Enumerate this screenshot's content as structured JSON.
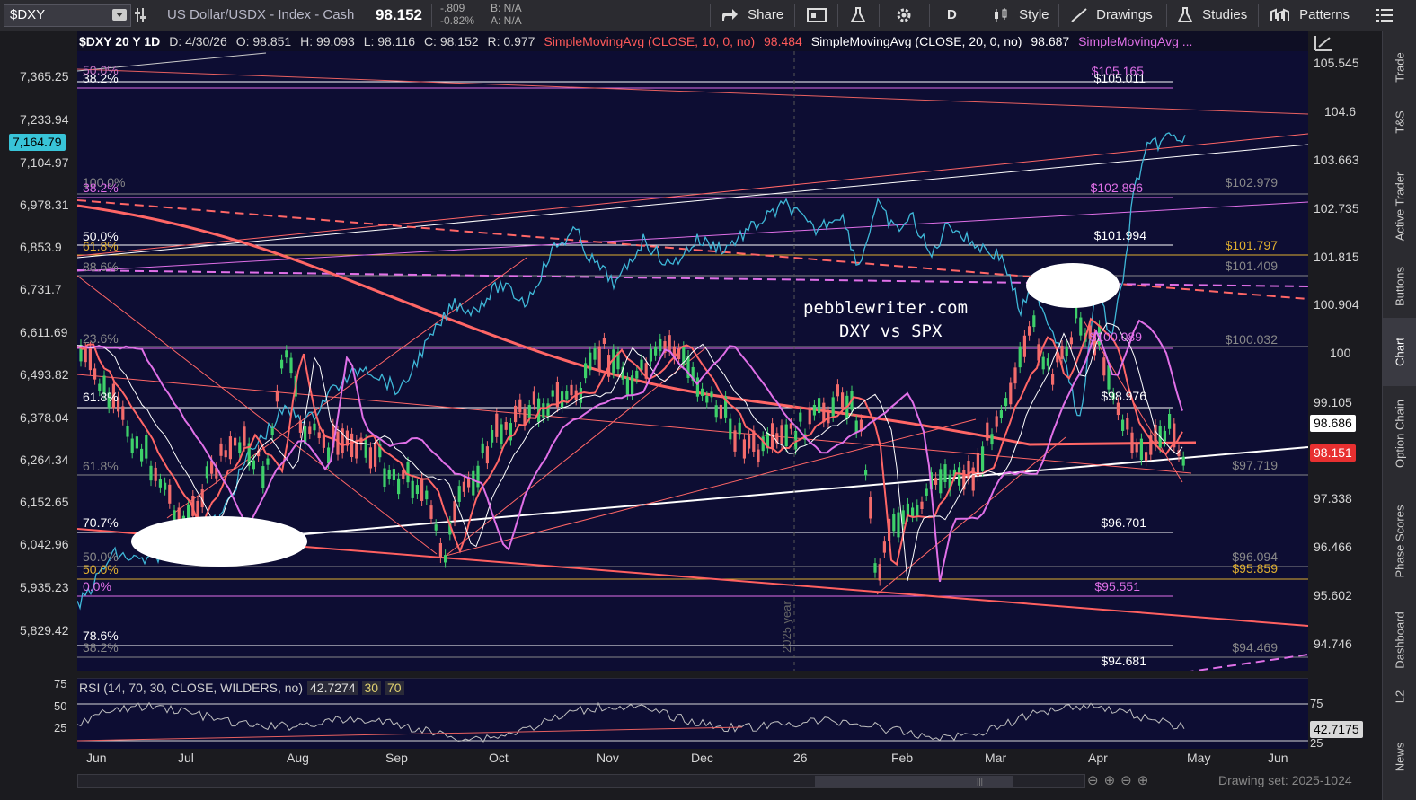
{
  "toolbar": {
    "symbol": "$DXY",
    "description": "US Dollar/USDX - Index - Cash",
    "last": "98.152",
    "change": "-.809",
    "change_pct": "-0.82%",
    "bid": "B: N/A",
    "ask": "A: N/A",
    "share": "Share",
    "aggregation": "D",
    "style": "Style",
    "drawings": "Drawings",
    "studies": "Studies",
    "patterns": "Patterns"
  },
  "infobar": {
    "chart_id": "$DXY 20 Y 1D",
    "date": "D: 4/30/26",
    "open": "O: 98.851",
    "high": "H: 99.093",
    "low": "L: 98.116",
    "close": "C: 98.152",
    "range": "R: 0.977",
    "sma10": "SimpleMovingAvg (CLOSE, 10, 0, no)",
    "sma10_val": "98.484",
    "sma20": "SimpleMovingAvg (CLOSE, 20, 0, no)",
    "sma20_val": "98.687",
    "sma_more": "SimpleMovingAvg ..."
  },
  "right_tabs": [
    "Trade",
    "T&S",
    "Active Trader",
    "Buttons",
    "Chart",
    "Option Chain",
    "Phase Scores",
    "Dashboard",
    "L2",
    "News"
  ],
  "left_axis": [
    "7,365.25",
    "7,233.94",
    "7,164.79",
    "7,104.97",
    "6,978.31",
    "6,853.9",
    "6,731.7",
    "6,611.69",
    "6,493.82",
    "6,378.04",
    "6,264.34",
    "6,152.65",
    "6,042.96",
    "5,935.23",
    "5,829.42"
  ],
  "right_axis": [
    "105.545",
    "104.6",
    "103.663",
    "102.735",
    "101.815",
    "100.904",
    "100",
    "99.105",
    "98.686",
    "98.151",
    "97.338",
    "96.466",
    "95.602",
    "94.746"
  ],
  "months": [
    "Jun",
    "Jul",
    "Aug",
    "Sep",
    "Oct",
    "Nov",
    "Dec",
    "26",
    "Feb",
    "Mar",
    "Apr",
    "May",
    "Jun"
  ],
  "year_marker": "2025 year",
  "watermark_1": "pebblewriter.com",
  "watermark_2": "DXY vs SPX",
  "fib_left": {
    "l50a": "50.0%",
    "l382a": "38.2%",
    "l100": "100.0%",
    "l382b": "38.2%",
    "l50b": "50.0%",
    "l618a": "61.8%",
    "l886": "88.6%",
    "l236": "23.6%",
    "l618b": "61.8%",
    "l618c": "61.8%",
    "l707": "70.7%",
    "l50c": "50.0%",
    "l50d": "50.0%",
    "l0": "0.0%",
    "l786": "78.6%",
    "l382c": "38.2%"
  },
  "levels": {
    "v105165": "$105.165",
    "v105011": "$105.011",
    "v102979": "$102.979",
    "v102896": "$102.896",
    "v101994": "$101.994",
    "v101797": "$101.797",
    "v101409": "$101.409",
    "v100089": "$100.089",
    "v100032": "$100.032",
    "v98976": "$98.976",
    "v97719": "$97.719",
    "v96701": "$96.701",
    "v96094": "$96.094",
    "v95859": "$95.859",
    "v95551": "$95.551",
    "v94681": "$94.681",
    "v94469": "$94.469"
  },
  "rsi": {
    "label": "RSI (14, 70, 30, CLOSE, WILDERS, no)",
    "value": "42.7274",
    "ob": "30",
    "os": "70",
    "axis": [
      "75",
      "50",
      "25"
    ],
    "flag": "42.7175"
  },
  "status": {
    "drawing_set": "Drawing set: 2025-1024"
  },
  "colors": {
    "chart_bg": "#0d0d33",
    "candle": "#f26b6b",
    "spx": "#3fb8d8",
    "sma": "#ff6666",
    "magenta": "#e070e8",
    "gold": "#e0b030"
  }
}
